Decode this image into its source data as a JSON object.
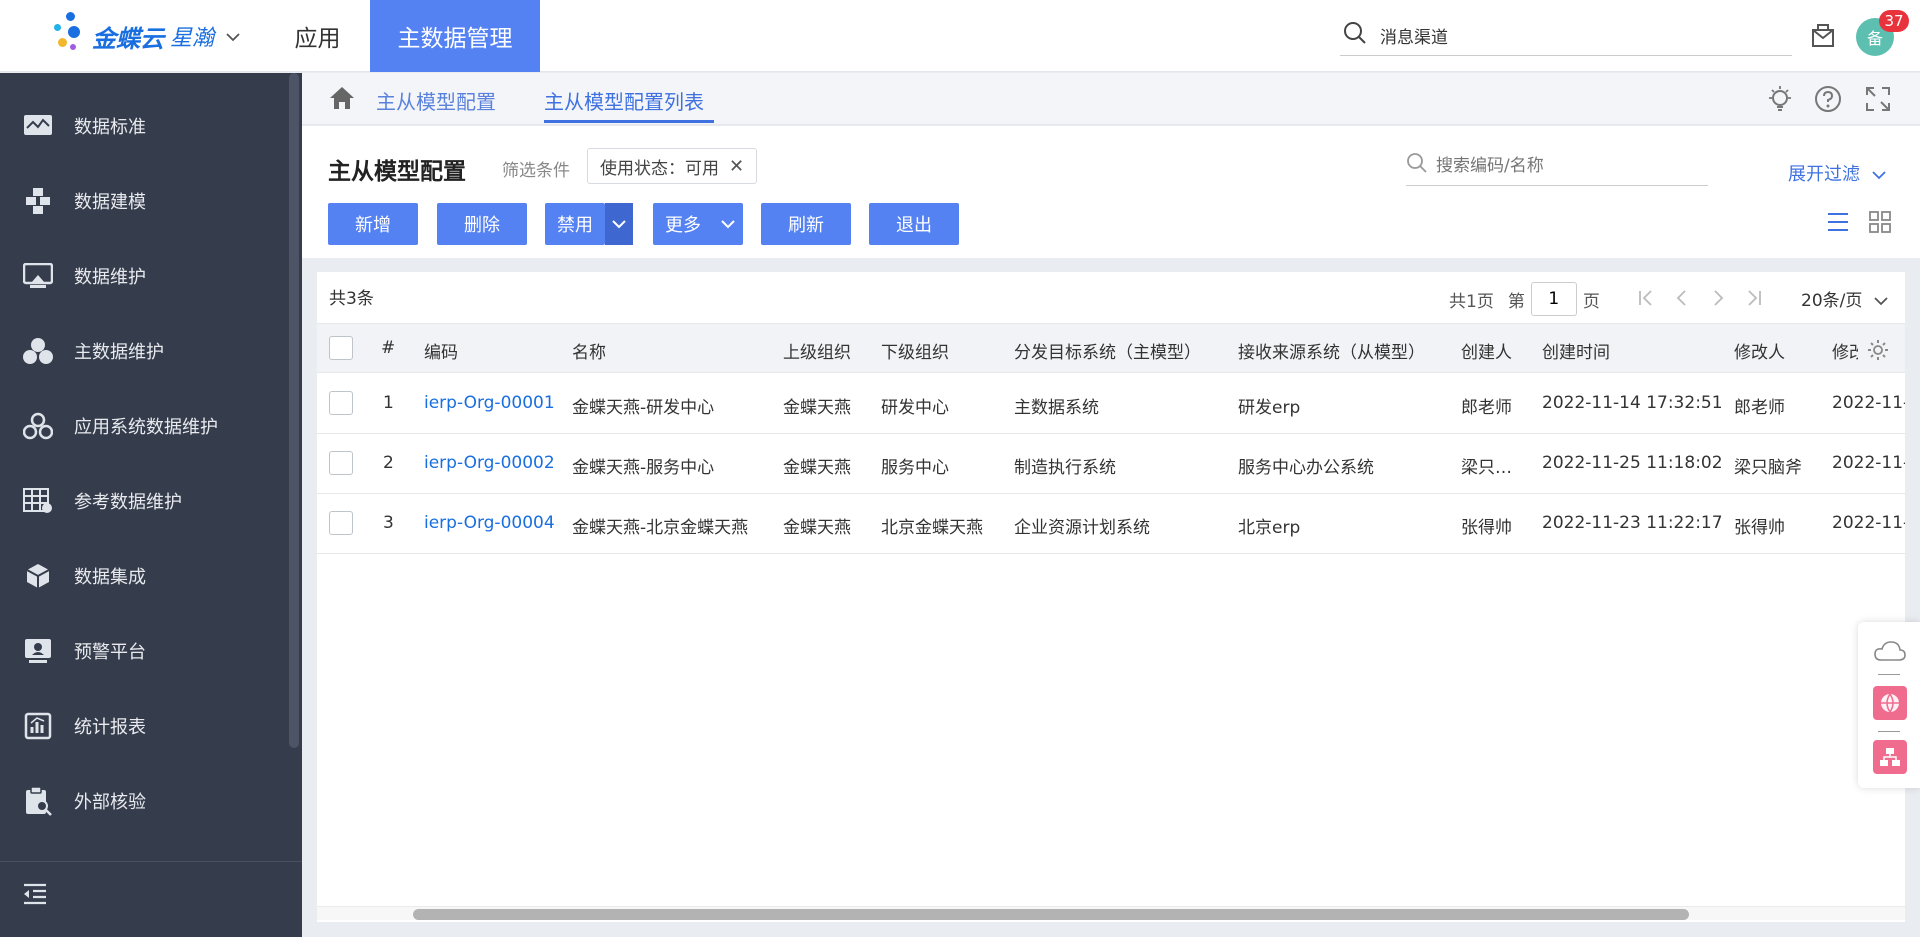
{
  "topbar": {
    "brand": "金蝶云",
    "brand_suffix": "星瀚",
    "nav_app": "应用",
    "nav_active": "主数据管理",
    "search_value": "消息渠道",
    "avatar_text": "备",
    "badge_count": "37"
  },
  "sidebar": {
    "items": [
      {
        "label": "数据标准",
        "icon": "data-standard-icon"
      },
      {
        "label": "数据建模",
        "icon": "data-modeling-icon"
      },
      {
        "label": "数据维护",
        "icon": "data-maintenance-icon"
      },
      {
        "label": "主数据维护",
        "icon": "master-data-icon"
      },
      {
        "label": "应用系统数据维护",
        "icon": "app-system-icon"
      },
      {
        "label": "参考数据维护",
        "icon": "reference-data-icon"
      },
      {
        "label": "数据集成",
        "icon": "data-integration-icon"
      },
      {
        "label": "预警平台",
        "icon": "alert-platform-icon"
      },
      {
        "label": "统计报表",
        "icon": "report-icon"
      },
      {
        "label": "外部核验",
        "icon": "external-verify-icon"
      }
    ]
  },
  "breadcrumb": {
    "item1": "主从模型配置",
    "item2": "主从模型配置列表"
  },
  "header": {
    "title": "主从模型配置",
    "filter_label": "筛选条件",
    "filter_chip": "使用状态：可用",
    "search_placeholder": "搜索编码/名称",
    "expand_filter": "展开过滤"
  },
  "toolbar": {
    "add": "新增",
    "delete": "删除",
    "disable": "禁用",
    "more": "更多",
    "refresh": "刷新",
    "exit": "退出"
  },
  "table": {
    "total": "共3条",
    "page_total": "共1页",
    "page_prefix": "第",
    "page_value": "1",
    "page_suffix": "页",
    "page_size": "20条/页",
    "columns": [
      "#",
      "编码",
      "名称",
      "上级组织",
      "下级组织",
      "分发目标系统（主模型）",
      "接收来源系统（从模型）",
      "创建人",
      "创建时间",
      "修改人",
      "修改"
    ],
    "rows": [
      {
        "index": "1",
        "code": "ierp-Org-00001",
        "name": "金蝶天燕-研发中心",
        "parent": "金蝶天燕",
        "child": "研发中心",
        "target": "主数据系统",
        "source": "研发erp",
        "creator": "郎老师",
        "created": "2022-11-14 17:32:51",
        "modifier": "郎老师",
        "modified": "2022-11-"
      },
      {
        "index": "2",
        "code": "ierp-Org-00002",
        "name": "金蝶天燕-服务中心",
        "parent": "金蝶天燕",
        "child": "服务中心",
        "target": "制造执行系统",
        "source": "服务中心办公系统",
        "creator": "梁只…",
        "created": "2022-11-25 11:18:02",
        "modifier": "梁只脑斧",
        "modified": "2022-11-"
      },
      {
        "index": "3",
        "code": "ierp-Org-00004",
        "name": "金蝶天燕-北京金蝶天燕",
        "parent": "金蝶天燕",
        "child": "北京金蝶天燕",
        "target": "企业资源计划系统",
        "source": "北京erp",
        "creator": "张得帅",
        "created": "2022-11-23 11:22:17",
        "modifier": "张得帅",
        "modified": "2022-11-"
      }
    ]
  },
  "colors": {
    "accent": "#5582f3",
    "sidebar_bg": "#353c4c",
    "link": "#1a6fe0",
    "badge": "#e8333d"
  }
}
